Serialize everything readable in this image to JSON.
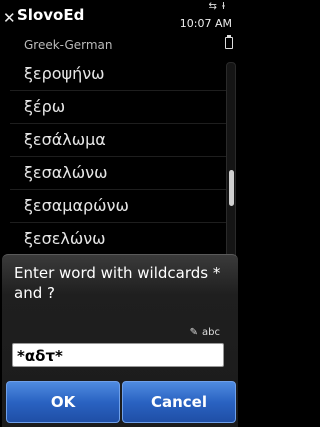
{
  "app": {
    "title": "SlovoEd",
    "close_glyph": "✕"
  },
  "status": {
    "time": "10:07 AM",
    "icons": "⇆ Ɨ"
  },
  "dictionary": {
    "label": "Greek-German"
  },
  "words": [
    "ξεροψήνω",
    "ξέρω",
    "ξεσάλωμα",
    "ξεσαλώνω",
    "ξεσαμαρώνω",
    "ξεσελώνω"
  ],
  "dialog": {
    "prompt": "Enter word with wildcards * and ?",
    "input_mode": "abc",
    "input_value": "*αδτ*",
    "ok_label": "OK",
    "cancel_label": "Cancel"
  },
  "colors": {
    "background": "#000000",
    "button": "#2a63c2",
    "field": "#ffffff"
  }
}
